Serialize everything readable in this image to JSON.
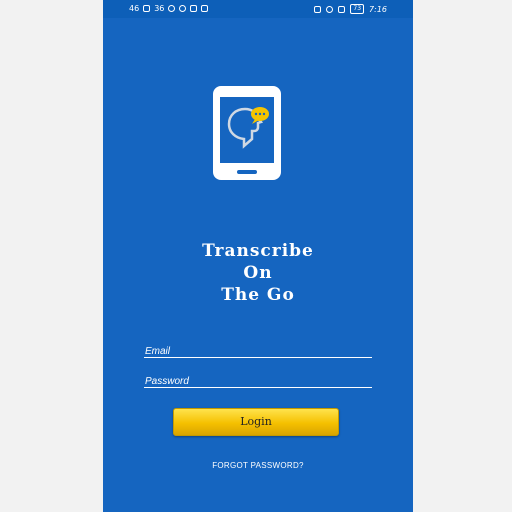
{
  "status_bar": {
    "left_indicators": [
      "46",
      "36"
    ],
    "time": "7:16",
    "battery_level": "73",
    "icons": [
      "signal-icon",
      "wifi-icon",
      "notification-icon",
      "gallery-icon",
      "check-icon",
      "vibrate-icon",
      "alarm-icon",
      "bluetooth-icon",
      "battery-icon"
    ]
  },
  "app": {
    "logo_icon": "phone-chat-logo-icon",
    "title_lines": [
      "Transcribe",
      "On",
      "The Go"
    ]
  },
  "form": {
    "email_placeholder": "Email",
    "password_placeholder": "Password",
    "login_label": "Login",
    "forgot_label": "FORGOT PASSWORD?"
  },
  "colors": {
    "background": "#1565c0",
    "button": "#f5c000",
    "text": "#ffffff"
  }
}
